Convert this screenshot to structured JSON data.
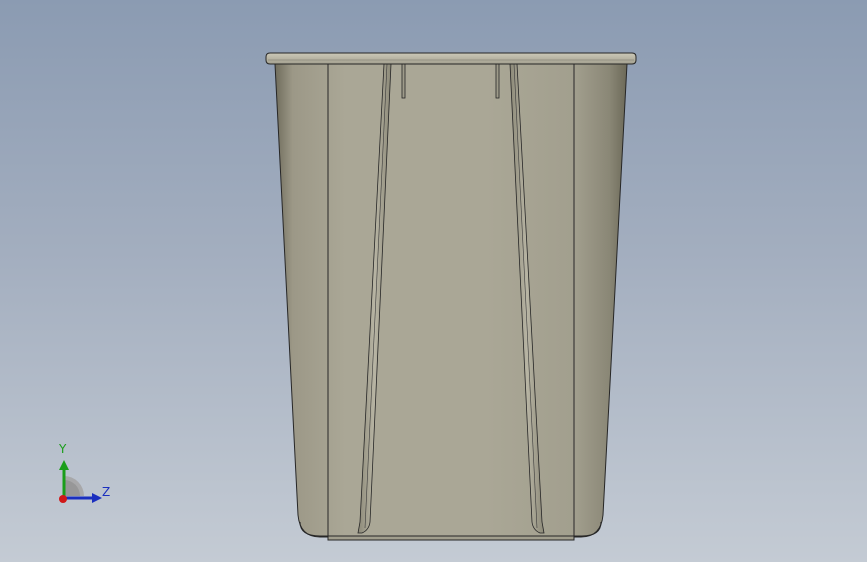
{
  "viewport": {
    "background_top": "#8b9bb2",
    "background_bottom": "#c4cbd4"
  },
  "model": {
    "description_icon": "bin-model",
    "body_color": "#a7a493",
    "rim_color": "#bdb9a9",
    "edge_color": "#262626"
  },
  "triad": {
    "y_label": "Y",
    "z_label": "Z",
    "y_color": "#1a9e1a",
    "z_color": "#1a2fbf",
    "x_color": "#d01818"
  }
}
